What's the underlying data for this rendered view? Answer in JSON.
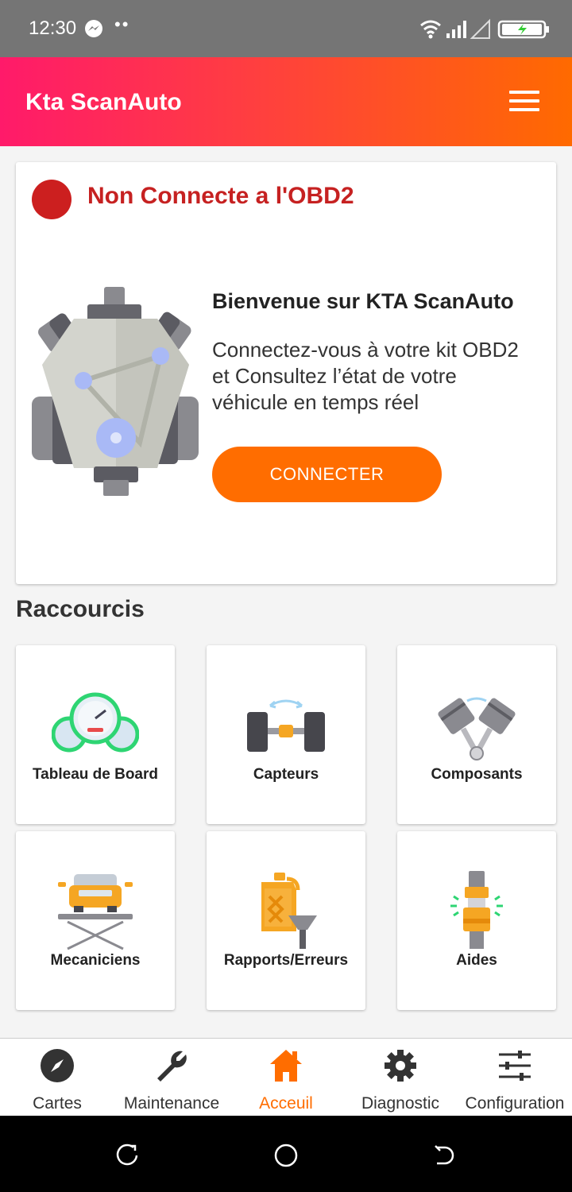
{
  "status_bar": {
    "time": "12:30",
    "dots": "••"
  },
  "app_bar": {
    "title": "Kta ScanAuto"
  },
  "status_card": {
    "status_text": "Non Connecte a l'OBD2",
    "status_color": "#cc1f1f",
    "welcome_title": "Bienvenue sur KTA ScanAuto",
    "welcome_text": "Connectez-vous à votre kit OBD2\net Consultez  l’état de votre\nvéhicule en temps réel",
    "connect_label": "CONNECTER"
  },
  "shortcuts": {
    "title": "Raccourcis",
    "items": [
      {
        "label": "Tableau de Board",
        "icon": "dashboard-gauge-icon"
      },
      {
        "label": "Capteurs",
        "icon": "sensor-axle-icon"
      },
      {
        "label": "Composants",
        "icon": "pistons-icon"
      },
      {
        "label": "Mecaniciens",
        "icon": "car-lift-icon"
      },
      {
        "label": "Rapports/Erreurs",
        "icon": "oil-can-icon"
      },
      {
        "label": "Aides",
        "icon": "spark-plug-icon"
      }
    ]
  },
  "bottom_nav": {
    "items": [
      {
        "label": "Cartes",
        "icon": "compass-icon"
      },
      {
        "label": "Maintenance",
        "icon": "wrench-icon"
      },
      {
        "label": "Acceuil",
        "icon": "home-icon",
        "active": true
      },
      {
        "label": "Diagnostic",
        "icon": "gear-icon"
      },
      {
        "label": "Configuration",
        "icon": "sliders-icon"
      }
    ]
  },
  "colors": {
    "accent": "#ff6d00",
    "header_gradient": [
      "#ff1a6a",
      "#ff6a00"
    ],
    "status_red": "#c62121"
  }
}
